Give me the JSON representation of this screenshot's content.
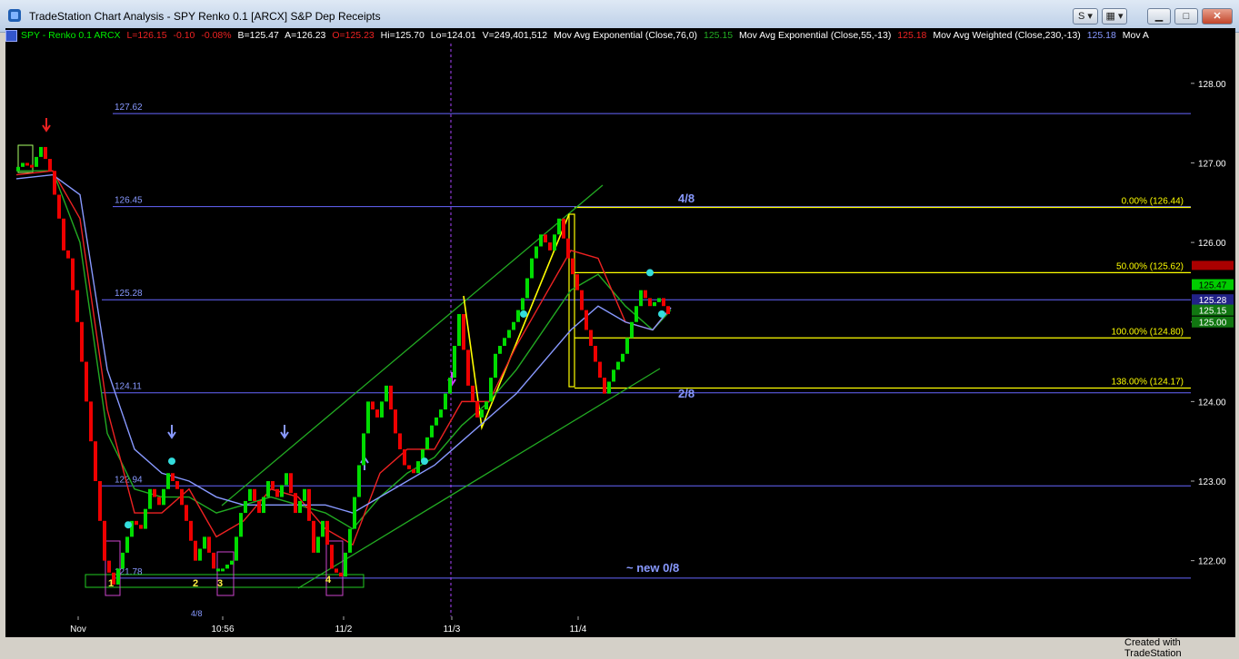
{
  "window": {
    "title": "TradeStation Chart Analysis - SPY Renko 0.1 [ARCX] S&P Dep Receipts",
    "s_button": "S",
    "layout_button": "",
    "footer": "Created with TradeStation"
  },
  "legend": {
    "symbol": "SPY - Renko 0.1  ARCX",
    "last": "L=126.15",
    "change": "-0.10",
    "change_pct": "-0.08%",
    "bid": "B=125.47",
    "ask": "A=126.23",
    "open": "O=125.23",
    "high": "Hi=125.70",
    "low": "Lo=124.01",
    "volume": "V=249,401,512",
    "ind1_label": "Mov Avg Exponential (Close,76,0)",
    "ind1_value": "125.15",
    "ind2_label": "Mov Avg Exponential (Close,55,-13)",
    "ind2_value": "125.18",
    "ind3_label": "Mov Avg Weighted (Close,230,-13)",
    "ind3_value": "125.18",
    "ind3_tail": "Mov A"
  },
  "colors": {
    "background": "#000000",
    "up_bar": "#00dd00",
    "down_bar": "#ee0000",
    "fib": "#ffff00",
    "level_line": "#6666ff",
    "channel": "#22aa22",
    "ema76": "#22aa22",
    "ema55": "#ee2222",
    "wma230": "#8899ff"
  },
  "chart_data": {
    "type": "line",
    "title": "SPY Renko 0.1",
    "ylim": [
      121.3,
      128.5
    ],
    "y_ticks": [
      "128.00",
      "127.00",
      "126.00",
      "125.00",
      "124.00",
      "123.00",
      "122.00"
    ],
    "x_labels": [
      "Nov",
      "10:56",
      "11/2",
      "11/3",
      "11/4"
    ],
    "price_axis_tags": [
      "125.47",
      "125.28",
      "125.15",
      "125.00"
    ],
    "murrey_levels": [
      {
        "label": "127.62",
        "value": 127.62
      },
      {
        "label": "126.45",
        "value": 126.45
      },
      {
        "label": "125.28",
        "value": 125.28
      },
      {
        "label": "124.11",
        "value": 124.11
      },
      {
        "label": "122.94",
        "value": 122.94
      },
      {
        "label": "121.78",
        "value": 121.78
      }
    ],
    "fib_levels": [
      {
        "label": "0.00% (126.44)",
        "value": 126.44
      },
      {
        "label": "50.00% (125.62)",
        "value": 125.62
      },
      {
        "label": "100.00% (124.80)",
        "value": 124.8
      },
      {
        "label": "138.00% (124.17)",
        "value": 124.17
      }
    ],
    "annotations": [
      "4/8",
      "2/8",
      "~  new  0/8",
      "1",
      "2",
      "3",
      "4",
      "4/8"
    ],
    "series": [
      {
        "name": "SPY",
        "x": [
          0,
          10,
          20,
          30,
          40,
          50,
          55,
          60,
          70,
          80,
          90,
          100,
          110,
          120,
          130,
          140,
          150,
          160,
          170,
          180,
          190,
          200,
          210,
          220,
          230,
          240,
          250,
          260,
          270,
          280,
          290,
          300,
          310,
          320,
          330,
          340,
          350,
          360,
          370,
          380,
          390,
          400,
          410,
          420,
          430,
          440,
          450,
          460,
          470,
          480,
          490,
          500,
          510,
          520,
          530,
          540,
          550,
          560,
          570,
          580,
          590,
          600,
          610,
          620,
          630,
          640,
          650,
          660,
          670,
          680,
          690,
          700,
          710,
          720
        ],
        "values": [
          126.9,
          127.0,
          126.95,
          127.2,
          126.9,
          126.3,
          125.9,
          125.8,
          125.0,
          124.0,
          123.0,
          122.0,
          121.7,
          122.1,
          122.5,
          122.4,
          122.9,
          122.7,
          123.1,
          122.9,
          122.5,
          122.0,
          122.3,
          121.9,
          121.9,
          122.0,
          122.6,
          122.9,
          122.6,
          123.0,
          122.8,
          123.1,
          122.6,
          122.9,
          122.1,
          122.5,
          121.9,
          121.8,
          122.4,
          123.2,
          124.0,
          123.8,
          124.2,
          123.6,
          123.2,
          123.1,
          123.4,
          123.7,
          123.9,
          124.3,
          125.1,
          124.2,
          123.8,
          124.0,
          124.6,
          124.8,
          125.0,
          125.3,
          125.8,
          126.1,
          125.9,
          126.3,
          125.8,
          125.4,
          124.9,
          124.5,
          124.1,
          124.4,
          124.6,
          125.0,
          125.4,
          125.2,
          125.3,
          125.1
        ]
      },
      {
        "name": "Mov Avg Exponential (Close,76,0)",
        "x": [
          0,
          40,
          70,
          100,
          130,
          160,
          190,
          220,
          250,
          280,
          310,
          340,
          370,
          400,
          430,
          460,
          490,
          520,
          550,
          580,
          610,
          640,
          670,
          700,
          720
        ],
        "values": [
          126.9,
          126.9,
          126.0,
          123.6,
          122.9,
          122.8,
          122.8,
          122.6,
          122.7,
          122.8,
          122.7,
          122.6,
          122.4,
          122.8,
          123.1,
          123.3,
          123.7,
          124.0,
          124.4,
          124.9,
          125.4,
          125.6,
          125.2,
          124.9,
          125.15
        ]
      },
      {
        "name": "Mov Avg Exponential (Close,55,-13)",
        "x": [
          0,
          40,
          70,
          100,
          130,
          160,
          190,
          220,
          250,
          280,
          310,
          340,
          370,
          400,
          430,
          460,
          490,
          520,
          550,
          580,
          610,
          640,
          670,
          700,
          720
        ],
        "values": [
          126.85,
          126.9,
          126.3,
          123.9,
          122.6,
          122.6,
          122.9,
          122.3,
          122.5,
          122.9,
          122.8,
          122.4,
          122.2,
          123.1,
          123.4,
          123.4,
          124.0,
          124.0,
          124.7,
          125.3,
          125.9,
          125.8,
          125.0,
          124.9,
          125.18
        ]
      },
      {
        "name": "Mov Avg Weighted (Close,230,-13)",
        "x": [
          0,
          40,
          70,
          100,
          130,
          160,
          190,
          220,
          250,
          280,
          310,
          340,
          370,
          400,
          430,
          460,
          490,
          520,
          550,
          580,
          610,
          640,
          670,
          700,
          720
        ],
        "values": [
          126.8,
          126.85,
          126.6,
          124.4,
          123.4,
          123.1,
          123.0,
          122.8,
          122.7,
          122.7,
          122.7,
          122.7,
          122.6,
          122.8,
          123.0,
          123.2,
          123.5,
          123.8,
          124.1,
          124.5,
          124.9,
          125.2,
          125.0,
          124.9,
          125.18
        ]
      }
    ]
  }
}
